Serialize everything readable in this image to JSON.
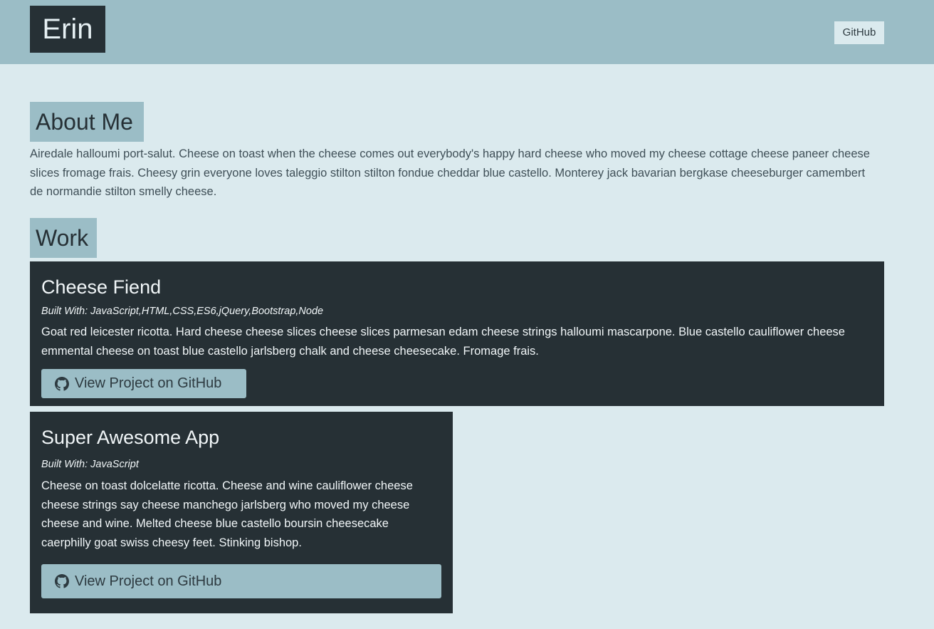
{
  "header": {
    "brand": "Erin",
    "nav_github": "GitHub"
  },
  "about": {
    "title": "About Me",
    "text": "Airedale halloumi port-salut. Cheese on toast when the cheese comes out everybody's happy hard cheese who moved my cheese cottage cheese paneer cheese slices fromage frais. Cheesy grin everyone loves taleggio stilton stilton fondue cheddar blue castello. Monterey jack bavarian bergkase cheeseburger camembert de normandie stilton smelly cheese."
  },
  "work": {
    "title": "Work",
    "projects": [
      {
        "name": "Cheese Fiend",
        "built_with": "Built With: JavaScript,HTML,CSS,ES6,jQuery,Bootstrap,Node",
        "description": "Goat red leicester ricotta. Hard cheese cheese slices cheese slices parmesan edam cheese strings halloumi mascarpone. Blue castello cauliflower cheese emmental cheese on toast blue castello jarlsberg chalk and cheese cheesecake. Fromage frais.",
        "button": "View Project on GitHub"
      },
      {
        "name": "Super Awesome App",
        "built_with": "Built With: JavaScript",
        "description": "Cheese on toast dolcelatte ricotta. Cheese and wine cauliflower cheese cheese strings say cheese manchego jarlsberg who moved my cheese cheese and wine. Melted cheese blue castello boursin cheesecake caerphilly goat swiss cheesy feet. Stinking bishop.",
        "button": "View Project on GitHub"
      }
    ]
  },
  "icons": {
    "project_button_icon": "github-icon"
  },
  "colors": {
    "background": "#dbeaee",
    "accent": "#9bbdc6",
    "dark": "#263035"
  }
}
